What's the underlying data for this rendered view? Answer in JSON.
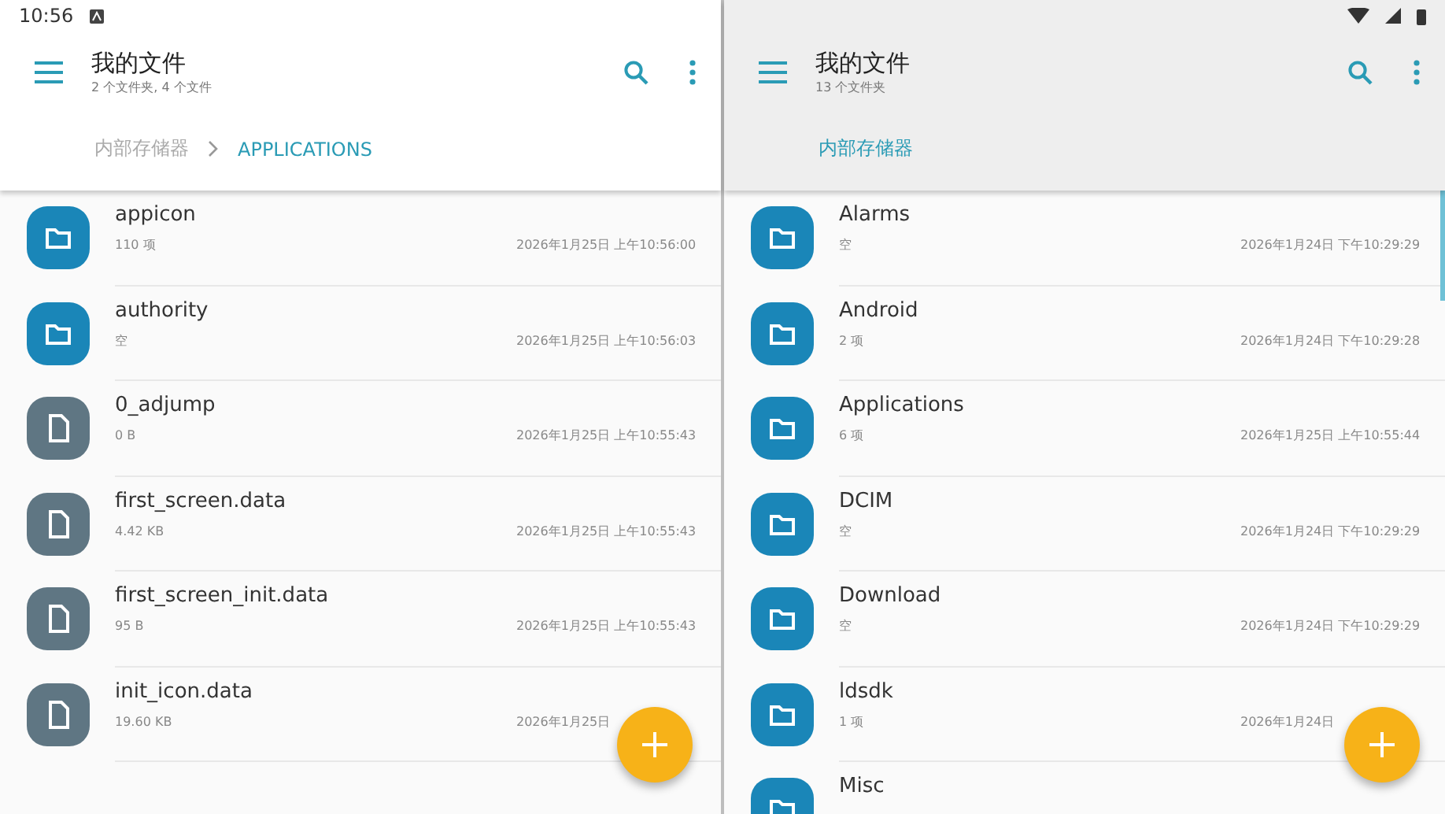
{
  "status_bar": {
    "time": "10:56"
  },
  "panes": [
    {
      "title": "我的文件",
      "subtitle": "2 个文件夹, 4 个文件",
      "selected": true,
      "breadcrumbs": [
        {
          "label": "内部存储器",
          "selected": false
        },
        {
          "label": "APPLICATIONS",
          "selected": true
        }
      ],
      "items": [
        {
          "kind": "folder",
          "name": "appicon",
          "detail": "110 项",
          "date": "2026年1月25日 上午10:56:00"
        },
        {
          "kind": "folder",
          "name": "authority",
          "detail": "空",
          "date": "2026年1月25日 上午10:56:03"
        },
        {
          "kind": "file",
          "name": "0_adjump",
          "detail": "0 B",
          "date": "2026年1月25日 上午10:55:43"
        },
        {
          "kind": "file",
          "name": "first_screen.data",
          "detail": "4.42 KB",
          "date": "2026年1月25日 上午10:55:43"
        },
        {
          "kind": "file",
          "name": "first_screen_init.data",
          "detail": "95 B",
          "date": "2026年1月25日 上午10:55:43"
        },
        {
          "kind": "file",
          "name": "init_icon.data",
          "detail": "19.60 KB",
          "date": "2026年1月25日"
        }
      ]
    },
    {
      "title": "我的文件",
      "subtitle": "13 个文件夹",
      "selected": false,
      "breadcrumbs": [
        {
          "label": "内部存储器",
          "selected": true
        }
      ],
      "items": [
        {
          "kind": "folder",
          "name": "Alarms",
          "detail": "空",
          "date": "2026年1月24日 下午10:29:29"
        },
        {
          "kind": "folder",
          "name": "Android",
          "detail": "2 项",
          "date": "2026年1月24日 下午10:29:28"
        },
        {
          "kind": "folder",
          "name": "Applications",
          "detail": "6 项",
          "date": "2026年1月25日 上午10:55:44"
        },
        {
          "kind": "folder",
          "name": "DCIM",
          "detail": "空",
          "date": "2026年1月24日 下午10:29:29"
        },
        {
          "kind": "folder",
          "name": "Download",
          "detail": "空",
          "date": "2026年1月24日 下午10:29:29"
        },
        {
          "kind": "folder",
          "name": "ldsdk",
          "detail": "1 项",
          "date": "2026年1月24日"
        },
        {
          "kind": "folder",
          "name": "Misc"
        }
      ]
    }
  ]
}
